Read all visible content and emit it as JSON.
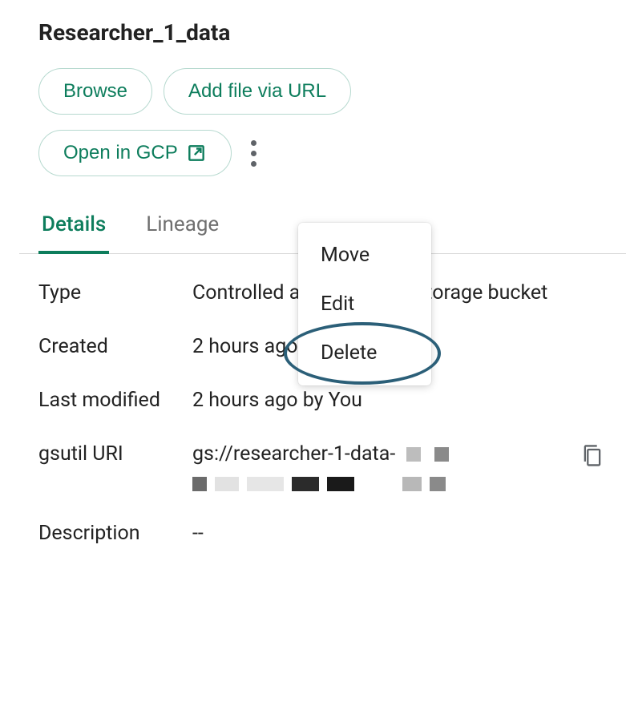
{
  "title": "Researcher_1_data",
  "actions": {
    "browse": "Browse",
    "add_url": "Add file via URL",
    "open_gcp": "Open in GCP"
  },
  "menu": {
    "move": "Move",
    "edit": "Edit",
    "delete": "Delete"
  },
  "tabs": {
    "details": "Details",
    "lineage": "Lineage"
  },
  "details": {
    "type_label": "Type",
    "type_value": "Controlled access Cloud Storage bucket",
    "created_label": "Created",
    "created_value": "2 hours ago by You",
    "modified_label": "Last modified",
    "modified_value": "2 hours ago by You",
    "gsutil_label": "gsutil URI",
    "gsutil_value": "gs://researcher-1-data-",
    "description_label": "Description",
    "description_value": "--"
  }
}
